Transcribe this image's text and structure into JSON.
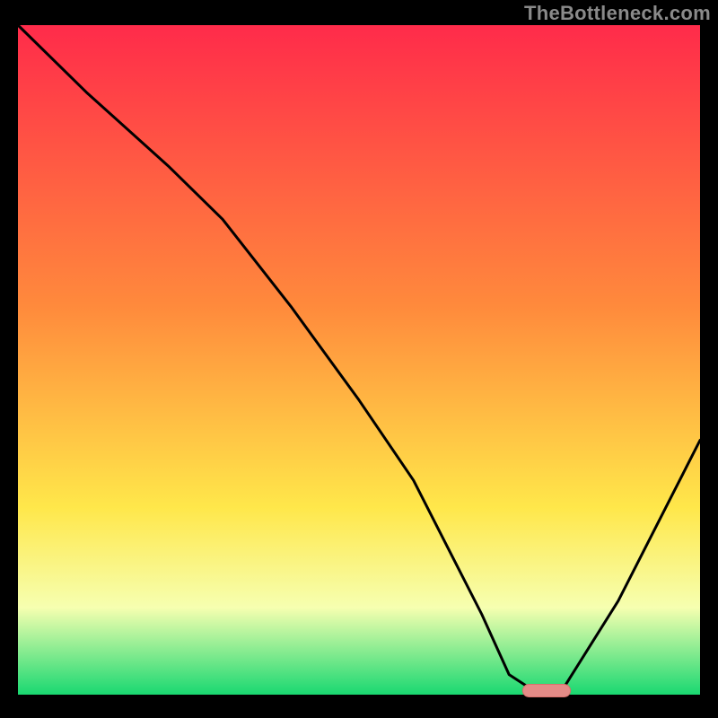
{
  "watermark": "TheBottleneck.com",
  "colors": {
    "frame": "#000000",
    "curve": "#000000",
    "marker_fill": "#e48b87",
    "marker_stroke": "#d96f6b",
    "grad_top": "#ff2b4a",
    "grad_orange": "#ff8a3c",
    "grad_yellow": "#ffe74a",
    "grad_pale": "#f6ffb0",
    "grad_green": "#19d871"
  },
  "chart_data": {
    "type": "line",
    "title": "",
    "xlabel": "",
    "ylabel": "",
    "xlim": [
      0,
      100
    ],
    "ylim": [
      0,
      100
    ],
    "legend": false,
    "annotations": [
      "TheBottleneck.com"
    ],
    "curve": {
      "name": "bottleneck-curve",
      "description": "Black V-shaped curve over vertical red→green heat gradient; minimum region marked with a small rounded pink bar.",
      "x": [
        0,
        10,
        22,
        30,
        40,
        50,
        58,
        63,
        68,
        72,
        75,
        80,
        88,
        96,
        100
      ],
      "y": [
        100,
        90,
        79,
        71,
        58,
        44,
        32,
        22,
        12,
        3,
        1,
        1,
        14,
        30,
        38
      ]
    },
    "optimal": {
      "x_center": 77.5,
      "width": 7,
      "y": 0.6
    }
  }
}
